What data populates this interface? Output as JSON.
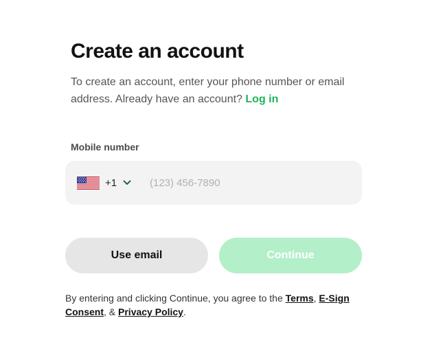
{
  "header": {
    "title": "Create an account",
    "intro_text": "To create an account, enter your phone number or email address. Already have an account?",
    "login_link": "Log in"
  },
  "phone_field": {
    "label": "Mobile number",
    "country_flag_icon": "us-flag-icon",
    "dial_code": "+1",
    "placeholder": "(123) 456-7890",
    "value": ""
  },
  "actions": {
    "use_email_label": "Use email",
    "continue_label": "Continue",
    "continue_enabled": false
  },
  "legal": {
    "prefix": "By entering and clicking Continue, you agree to the",
    "terms_link": "Terms",
    "separator_1": ",",
    "esign_link": "E-Sign Consent",
    "separator_2": ", &",
    "privacy_link": "Privacy Policy",
    "suffix": "."
  },
  "colors": {
    "accent": "#19b85a",
    "continue_disabled_bg": "#b3efc9",
    "input_bg": "#f3f3f3",
    "secondary_button_bg": "#e6e6e6"
  }
}
